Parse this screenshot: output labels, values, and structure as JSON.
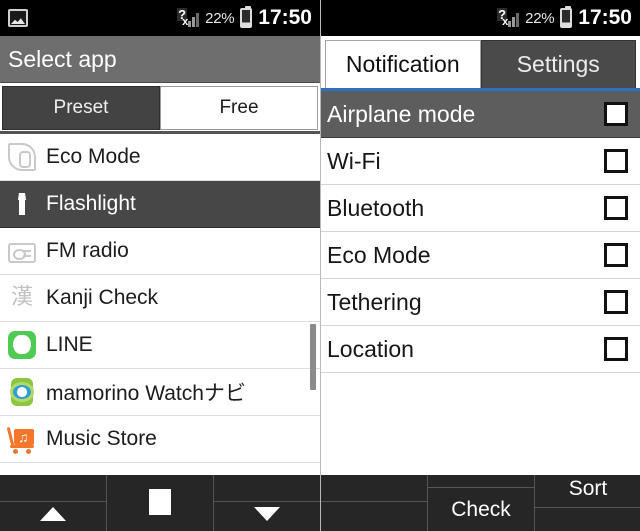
{
  "status_bar": {
    "notification_icon": "image-icon",
    "signal_icon": "signal-no-service-icon",
    "battery_percent": "22%",
    "battery_icon": "battery-low-icon",
    "time": "17:50"
  },
  "left_panel": {
    "title": "Select app",
    "segmented": {
      "selected": "Free",
      "options": [
        {
          "label": "Preset",
          "selected": false
        },
        {
          "label": "Free",
          "selected": true
        }
      ]
    },
    "apps": [
      {
        "label": "Eco Mode",
        "icon": "eco-leaf-icon",
        "selected": false
      },
      {
        "label": "Flashlight",
        "icon": "flashlight-icon",
        "selected": true
      },
      {
        "label": "FM radio",
        "icon": "radio-icon",
        "selected": false
      },
      {
        "label": "Kanji Check",
        "icon": "kanji-icon",
        "glyph": "漢",
        "selected": false
      },
      {
        "label": "LINE",
        "icon": "line-app-icon",
        "selected": false
      },
      {
        "label": "mamorino Watchナビ",
        "icon": "watch-icon",
        "selected": false
      },
      {
        "label": "Music Store",
        "icon": "music-store-icon",
        "selected": false
      }
    ],
    "bottom_bar": [
      {
        "label": "",
        "icon": "triangle-up-icon",
        "name": "scroll-up-button"
      },
      {
        "label": "",
        "icon": "square-icon",
        "name": "home-button"
      },
      {
        "label": "",
        "icon": "triangle-down-icon",
        "name": "scroll-down-button"
      }
    ]
  },
  "right_panel": {
    "tabs": [
      {
        "label": "Notification",
        "selected": true
      },
      {
        "label": "Settings",
        "selected": false
      }
    ],
    "accent_color": "#2f6fc4",
    "settings": [
      {
        "label": "Airplane mode",
        "checked": false,
        "selected": true
      },
      {
        "label": "Wi-Fi",
        "checked": false,
        "selected": false
      },
      {
        "label": "Bluetooth",
        "checked": false,
        "selected": false
      },
      {
        "label": "Eco Mode",
        "checked": false,
        "selected": false
      },
      {
        "label": "Tethering",
        "checked": false,
        "selected": false
      },
      {
        "label": "Location",
        "checked": false,
        "selected": false
      }
    ],
    "bottom_bar": [
      {
        "label": "",
        "name": "blank-button"
      },
      {
        "label": "Check",
        "name": "check-button"
      },
      {
        "label": "Sort",
        "name": "sort-button"
      }
    ]
  }
}
